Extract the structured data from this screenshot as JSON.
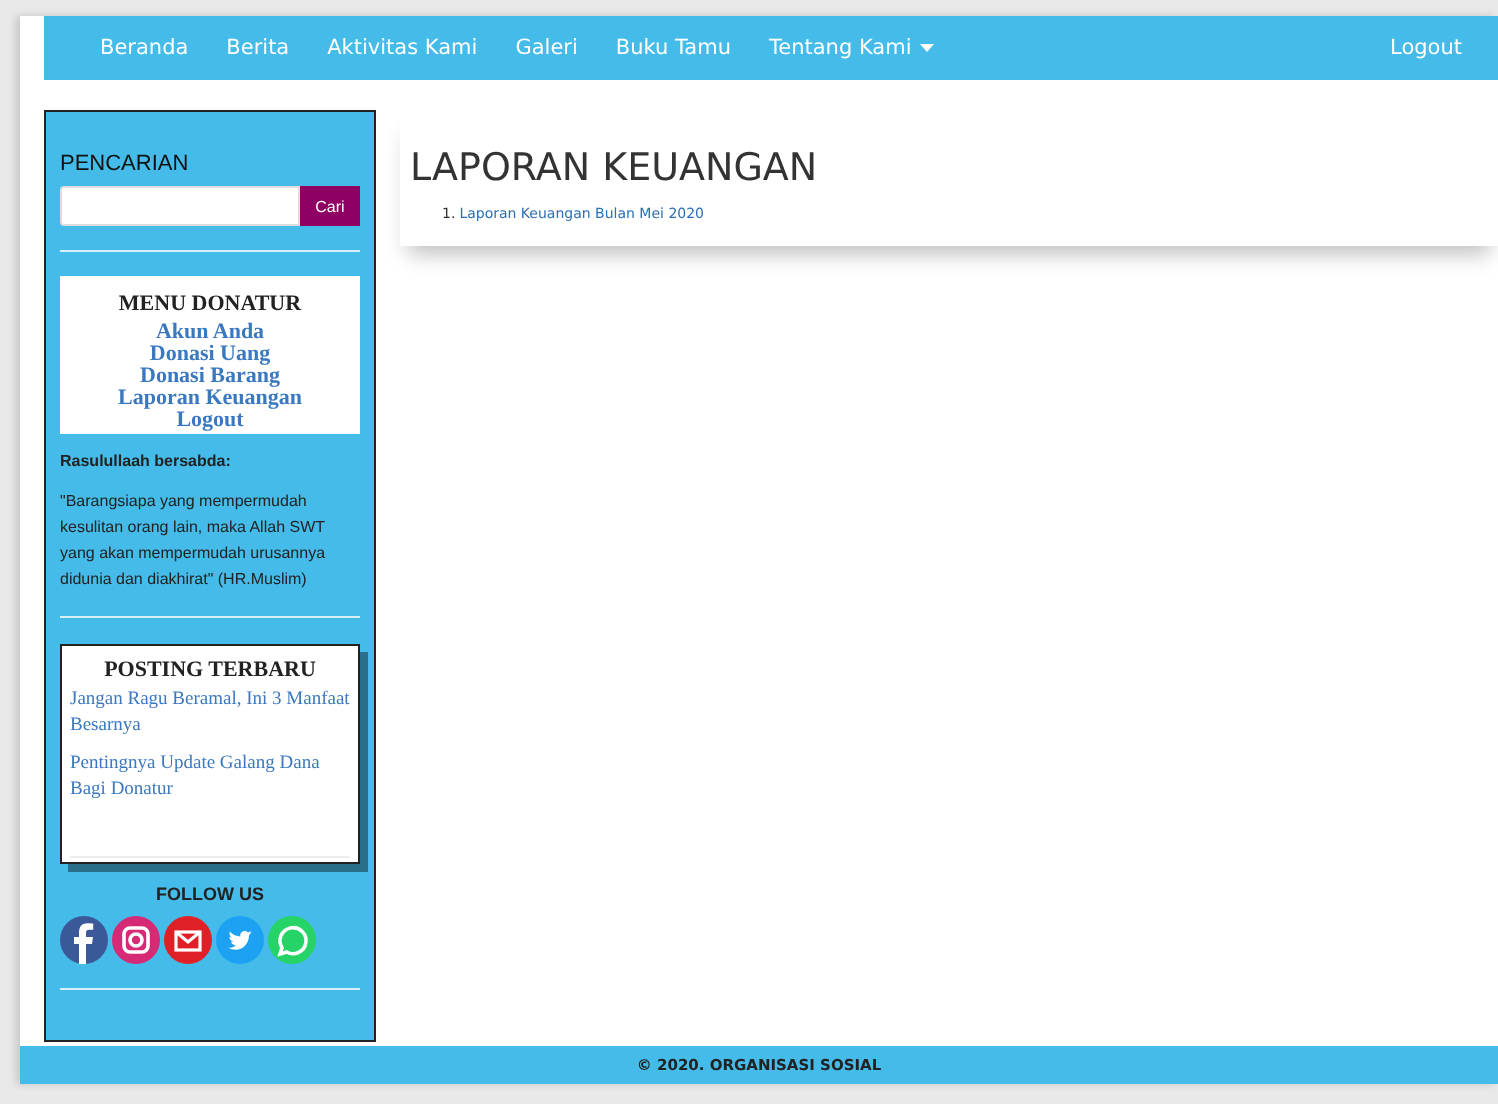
{
  "navbar": {
    "items": [
      {
        "label": "Beranda",
        "kind": "link"
      },
      {
        "label": "Berita",
        "kind": "link"
      },
      {
        "label": "Aktivitas Kami",
        "kind": "link"
      },
      {
        "label": "Galeri",
        "kind": "link"
      },
      {
        "label": "Buku Tamu",
        "kind": "link"
      },
      {
        "label": "Tentang Kami",
        "kind": "dropdown"
      }
    ],
    "right": "Logout"
  },
  "sidebar": {
    "search": {
      "title": "PENCARIAN",
      "button": "Cari"
    },
    "menu": {
      "title": "MENU DONATUR",
      "items": [
        "Akun Anda",
        "Donasi Uang",
        "Donasi Barang",
        "Laporan Keuangan",
        "Logout"
      ]
    },
    "quote": {
      "title": "Rasulullaah bersabda:",
      "text": "\"Barangsiapa yang  mempermudah kesulitan orang lain, maka Allah SWT yang akan mempermudah urusannya didunia dan diakhirat\" (HR.Muslim)"
    },
    "posts": {
      "title": "POSTING TERBARU",
      "items": [
        "Jangan Ragu Beramal, Ini 3 Manfaat Besarnya",
        "Pentingnya Update Galang Dana Bagi Donatur"
      ]
    },
    "follow": {
      "title": "FOLLOW US",
      "icons": [
        {
          "kind": "facebook",
          "color": "#3b5998"
        },
        {
          "kind": "instagram",
          "color": "#d62976"
        },
        {
          "kind": "mail",
          "color": "#e02027"
        },
        {
          "kind": "twitter",
          "color": "#1da1f2"
        },
        {
          "kind": "whatsapp",
          "color": "#25d366"
        }
      ]
    }
  },
  "main": {
    "title": "LAPORAN KEUANGAN",
    "reports": [
      {
        "number": "1.",
        "label": "Laporan Keuangan Bulan Mei 2020"
      }
    ]
  },
  "footer": "© 2020. ORGANISASI SOSIAL"
}
